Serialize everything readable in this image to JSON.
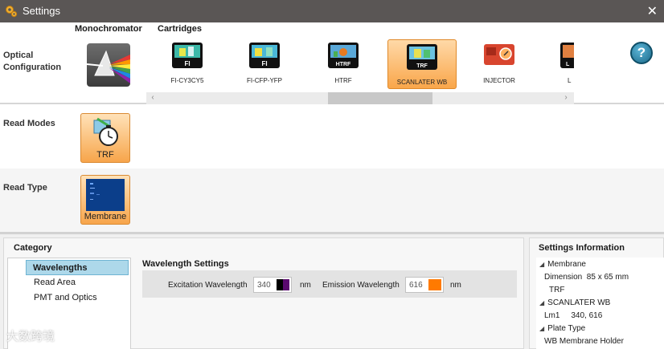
{
  "window": {
    "title": "Settings",
    "close_glyph": "✕"
  },
  "optical": {
    "row_label": "Optical\nConfiguration",
    "monochromator_header": "Monochromator",
    "cartridges_header": "Cartridges",
    "cartridges": [
      {
        "label": "FI-CY3CY5",
        "badge": "FI",
        "selected": false
      },
      {
        "label": "FI-CFP-YFP",
        "badge": "FI",
        "selected": false
      },
      {
        "label": "HTRF",
        "badge": "HTRF",
        "selected": false
      },
      {
        "label": "SCANLATER WB",
        "badge": "TRF",
        "selected": true
      },
      {
        "label": "INJECTOR",
        "badge": "",
        "selected": false
      },
      {
        "label": "L",
        "badge": "L",
        "selected": false
      }
    ],
    "scroll_left": "‹",
    "scroll_right": "›"
  },
  "help": {
    "glyph": "?"
  },
  "read_modes": {
    "row_label": "Read Modes",
    "tile_label": "TRF"
  },
  "read_type": {
    "row_label": "Read Type",
    "tile_label": "Membrane"
  },
  "category": {
    "title": "Category",
    "items": [
      {
        "label": "Wavelengths",
        "selected": true
      },
      {
        "label": "Read Area",
        "selected": false
      },
      {
        "label": "PMT and Optics",
        "selected": false
      }
    ]
  },
  "wavelength_settings": {
    "title": "Wavelength Settings",
    "excitation_label": "Excitation Wavelength",
    "excitation_value": "340",
    "excitation_color": "#5a0a6e",
    "emission_label": "Emission Wavelength",
    "emission_value": "616",
    "emission_color": "#ff7a00",
    "unit": "nm"
  },
  "settings_info": {
    "title": "Settings Information",
    "lines": [
      {
        "text": "Membrane",
        "level": 1
      },
      {
        "text": "Dimension  85 x 65 mm",
        "level": 2
      },
      {
        "text": "TRF",
        "level": 3
      },
      {
        "text": "SCANLATER WB",
        "level": 1
      },
      {
        "text": "Lm1     340, 616",
        "level": 2
      },
      {
        "text": "Plate Type",
        "level": 1
      },
      {
        "text": "WB Membrane Holder",
        "level": 2
      }
    ]
  },
  "watermark": "大数跨境"
}
